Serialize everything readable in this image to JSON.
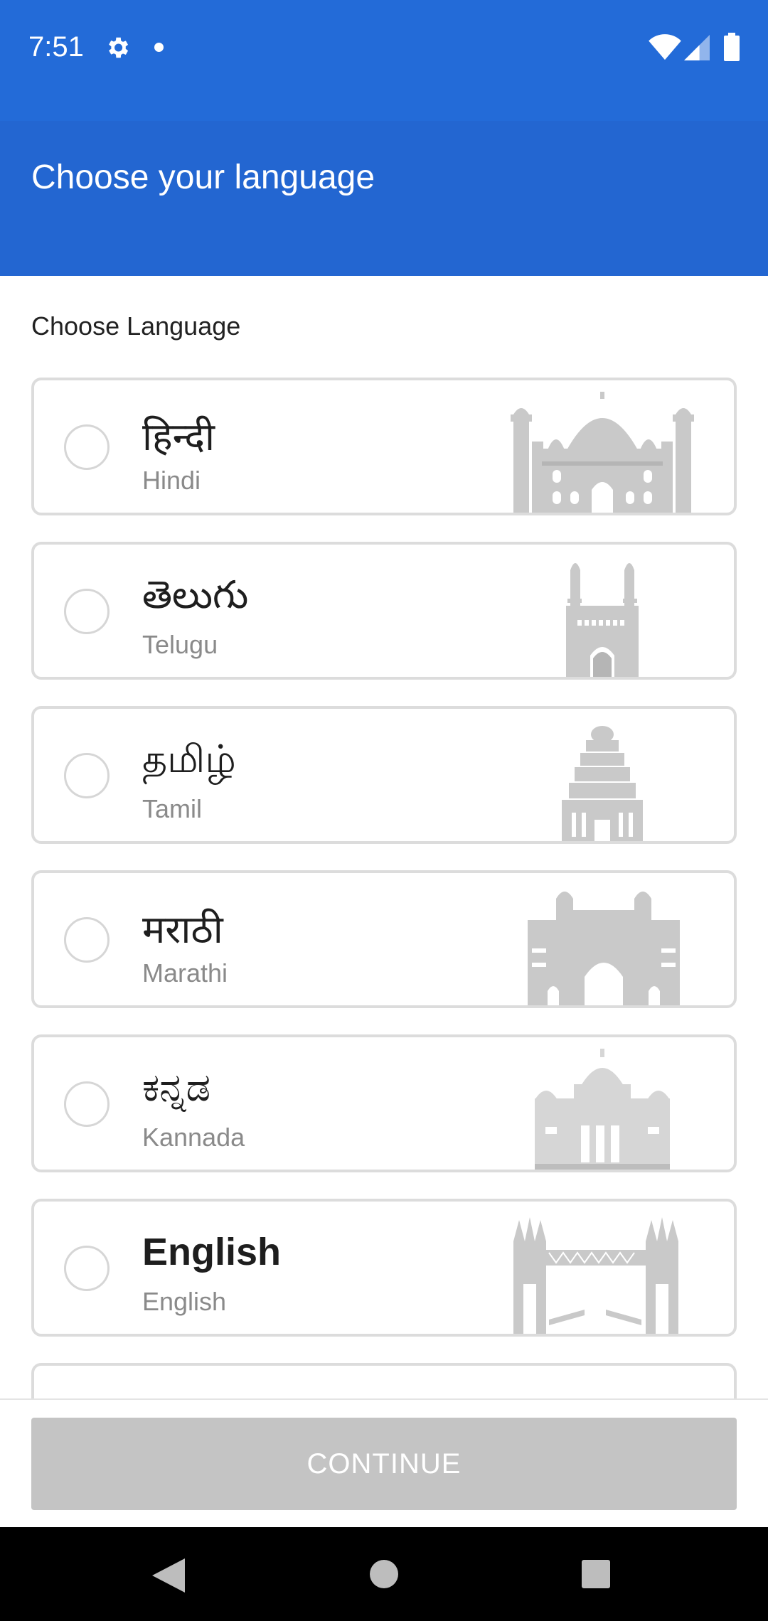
{
  "status_bar": {
    "time": "7:51",
    "icons": [
      "gear-icon",
      "notification-dot-icon",
      "wifi-icon",
      "signal-icon",
      "battery-icon"
    ]
  },
  "app_bar": {
    "title": "Choose your language"
  },
  "content": {
    "section_label": "Choose Language",
    "languages": [
      {
        "native": "हिन्दी",
        "english": "Hindi",
        "monument_icon": "taj-mahal-icon",
        "selected": false
      },
      {
        "native": "తెలుగు",
        "english": "Telugu",
        "monument_icon": "charminar-icon",
        "selected": false
      },
      {
        "native": "தமிழ்",
        "english": "Tamil",
        "monument_icon": "temple-gopuram-icon",
        "selected": false
      },
      {
        "native": "मराठी",
        "english": "Marathi",
        "monument_icon": "gateway-of-india-icon",
        "selected": false
      },
      {
        "native": "ಕನ್ನಡ",
        "english": "Kannada",
        "monument_icon": "vidhana-soudha-icon",
        "selected": false
      },
      {
        "native": "English",
        "english": "English",
        "monument_icon": "tower-bridge-icon",
        "selected": false
      }
    ]
  },
  "footer": {
    "continue_label": "CONTINUE",
    "continue_enabled": false
  },
  "colors": {
    "status_bar": "#236bd8",
    "app_bar": "#2366d1",
    "button_disabled": "#c4c4c4",
    "monument": "#c9c9c9"
  }
}
